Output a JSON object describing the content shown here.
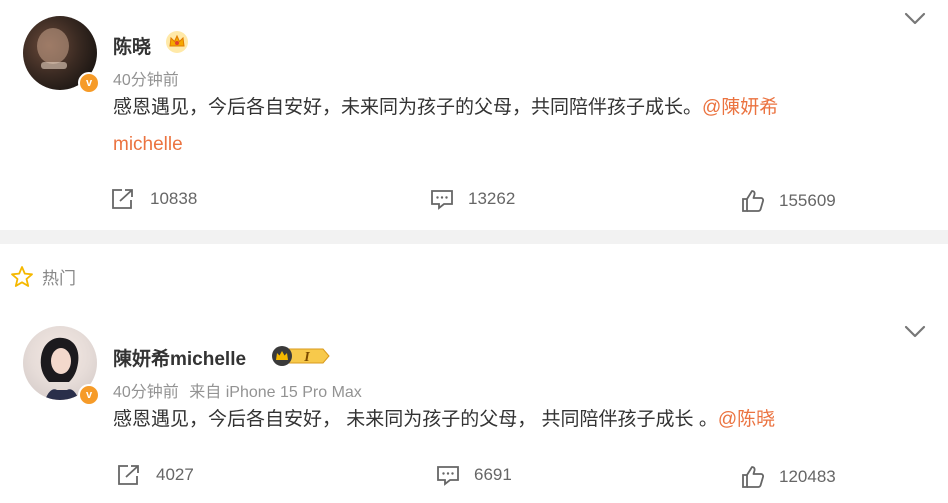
{
  "post1": {
    "author": "陈晓",
    "time": "40分钟前",
    "text": "感恩遇见，今后各自安好，未来同为孩子的父母，共同陪伴孩子成长。",
    "mention_line1": "@陳妍希",
    "mention_line2": "michelle",
    "repost": "10838",
    "comment": "13262",
    "like": "155609"
  },
  "hot_label": "热门",
  "post2": {
    "author": "陳妍希michelle",
    "level": "I",
    "time": "40分钟前",
    "source": "来自 iPhone 15 Pro Max",
    "text": "感恩遇见，今后各自安好， 未来同为孩子的父母， 共同陪伴孩子成长 。",
    "mention": "@陈晓",
    "repost": "4027",
    "comment": "6691",
    "like": "120483"
  },
  "colors": {
    "accent": "#eb7340",
    "verified": "#f69b28",
    "gold": "#f5b800"
  }
}
